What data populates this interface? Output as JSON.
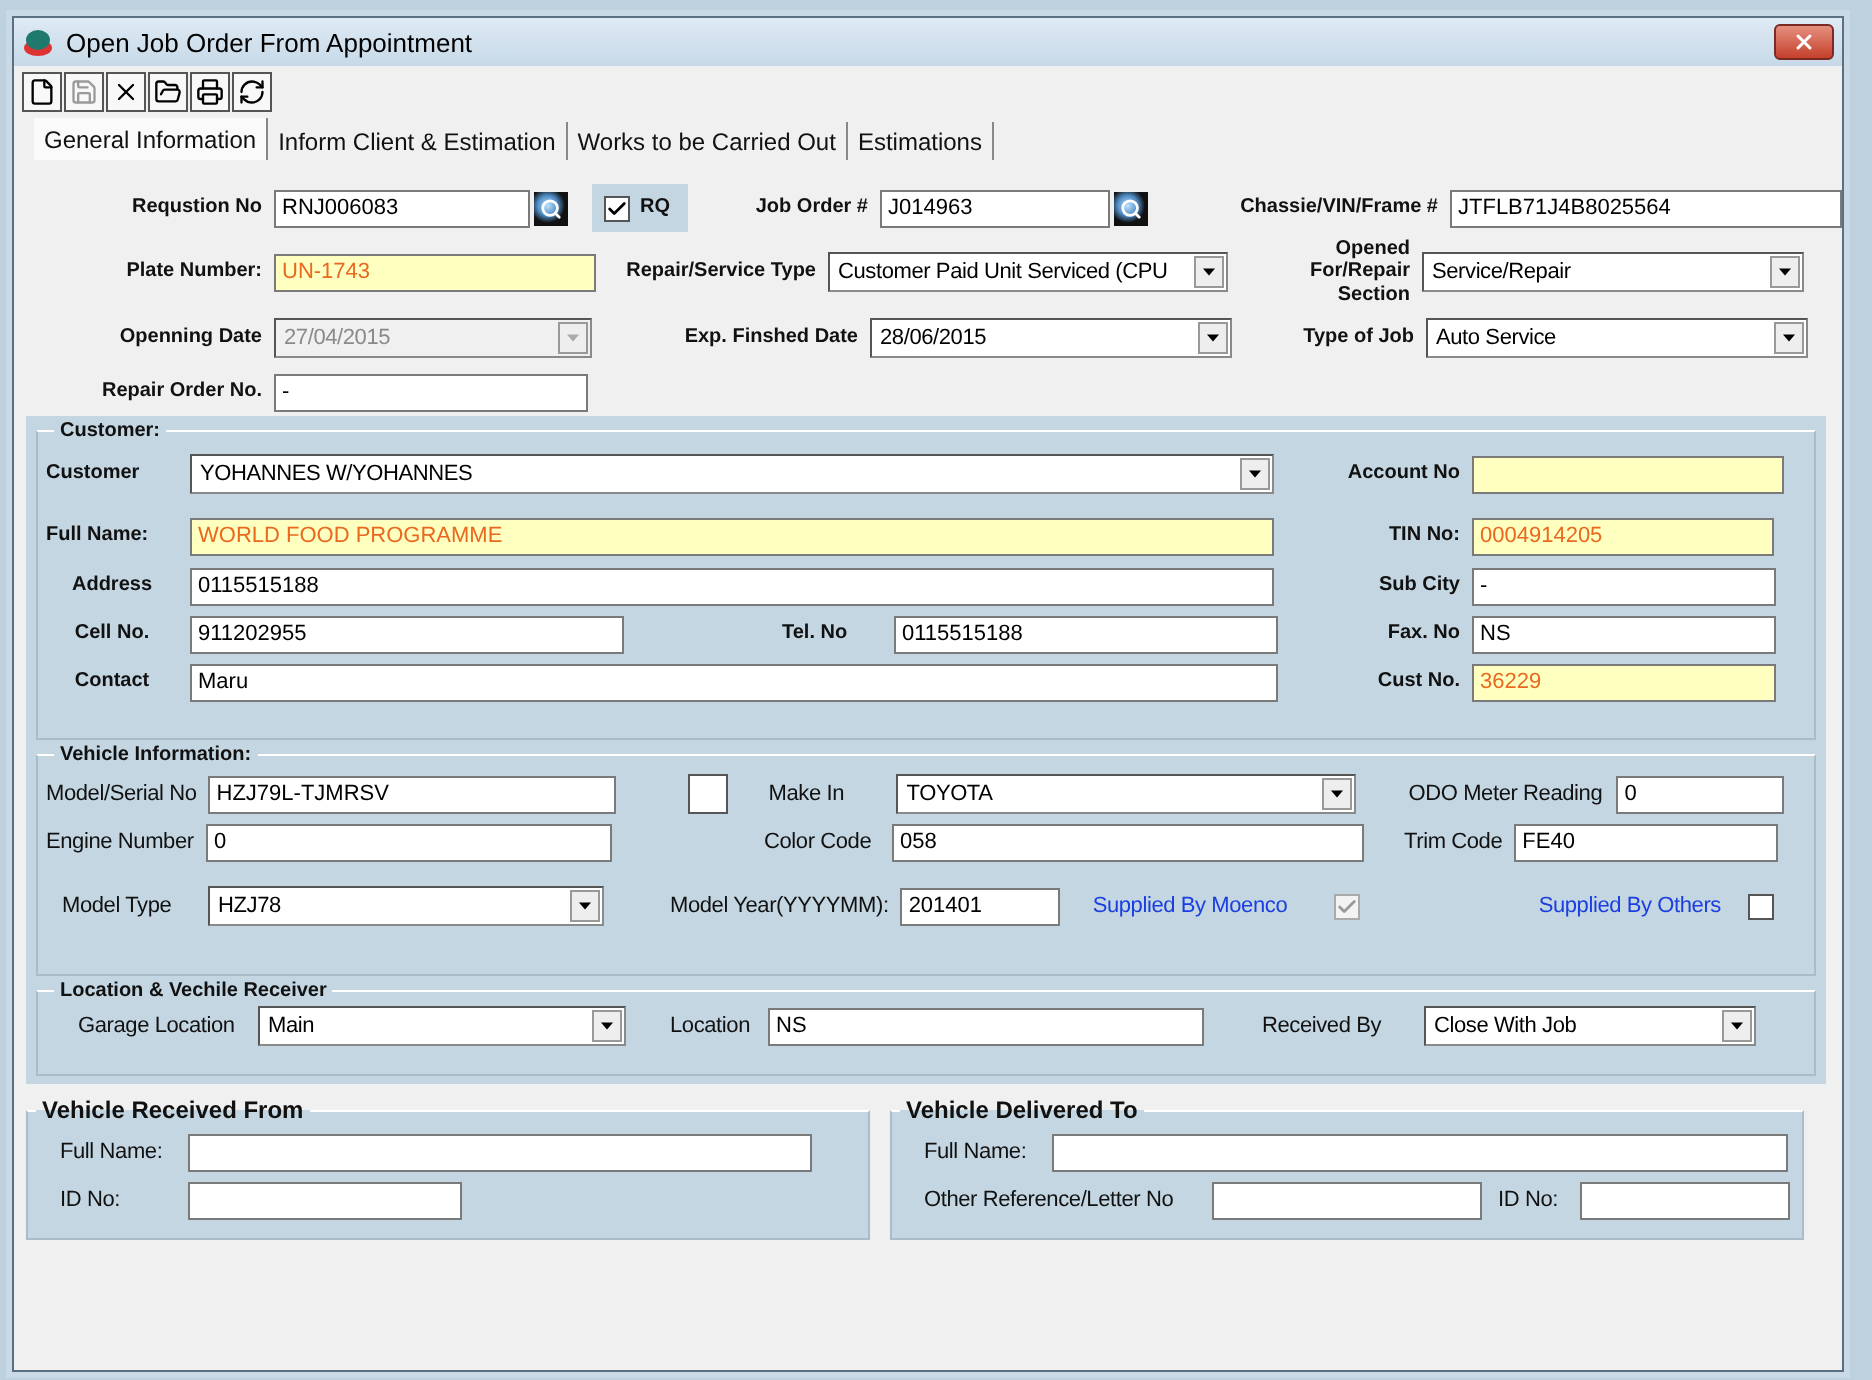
{
  "window": {
    "title": "Open Job Order From Appointment"
  },
  "toolbar": [
    {
      "kind": "new",
      "disabled": false
    },
    {
      "kind": "save",
      "disabled": true
    },
    {
      "kind": "delete",
      "disabled": false
    },
    {
      "kind": "open",
      "disabled": false
    },
    {
      "kind": "print",
      "disabled": false
    },
    {
      "kind": "refresh",
      "disabled": false
    }
  ],
  "tabs": [
    {
      "label": "General Information",
      "selected": true
    },
    {
      "label": "Inform Client & Estimation",
      "selected": false
    },
    {
      "label": "Works to be Carried Out",
      "selected": false
    },
    {
      "label": "Estimations",
      "selected": false
    }
  ],
  "header": {
    "fields": [
      {
        "label": "Requstion No",
        "kind": "lookup",
        "value": "RNJ006083",
        "highlighted": false,
        "disabled": false
      },
      {
        "label": "RQ",
        "kind": "checkbox",
        "checked": true,
        "disabled": false
      },
      {
        "label": "Job Order #",
        "kind": "lookup",
        "value": "J014963",
        "highlighted": false,
        "disabled": false
      },
      {
        "label": "Chassie/VIN/Frame #",
        "kind": "text",
        "value": "JTFLB71J4B8025564",
        "highlighted": false,
        "disabled": false
      },
      {
        "label": "Plate Number:",
        "kind": "text",
        "value": "UN-1743",
        "highlighted": true,
        "disabled": false
      },
      {
        "label": "Repair/Service Type",
        "kind": "combo",
        "value": "Customer Paid Unit Serviced (CPU",
        "highlighted": false,
        "disabled": false
      },
      {
        "label": "Opened For/Repair Section",
        "kind": "combo",
        "value": "Service/Repair",
        "highlighted": false,
        "disabled": false
      },
      {
        "label": "Openning Date",
        "kind": "combo",
        "value": "27/04/2015",
        "highlighted": false,
        "disabled": true
      },
      {
        "label": "Exp. Finshed Date",
        "kind": "combo",
        "value": "28/06/2015",
        "highlighted": false,
        "disabled": false
      },
      {
        "label": "Type of Job",
        "kind": "combo",
        "value": "Auto Service",
        "highlighted": false,
        "disabled": false
      },
      {
        "label": "Repair Order No.",
        "kind": "text",
        "value": "-",
        "highlighted": false,
        "disabled": false
      }
    ]
  },
  "customer": {
    "title": "Customer:",
    "fields": [
      {
        "label": "Customer",
        "kind": "combo",
        "value": "YOHANNES W/YOHANNES",
        "highlighted": false,
        "disabled": false
      },
      {
        "label": "Account No",
        "kind": "text",
        "highlighted": true,
        "disabled": false
      },
      {
        "label": "Full Name:",
        "kind": "text",
        "value": "WORLD FOOD PROGRAMME",
        "highlighted": true,
        "disabled": false
      },
      {
        "label": "TIN No:",
        "kind": "text",
        "value": "0004914205",
        "highlighted": true,
        "disabled": false
      },
      {
        "label": "Address",
        "kind": "text",
        "value": "0115515188",
        "highlighted": false,
        "disabled": false
      },
      {
        "label": "Sub City",
        "kind": "text",
        "value": "-",
        "highlighted": false,
        "disabled": false
      },
      {
        "label": "Cell No.",
        "kind": "text",
        "value": "911202955",
        "highlighted": false,
        "disabled": false
      },
      {
        "label": "Tel. No",
        "kind": "text",
        "value": "0115515188",
        "highlighted": false,
        "disabled": false
      },
      {
        "label": "Fax. No",
        "kind": "text",
        "value": "NS",
        "highlighted": false,
        "disabled": false
      },
      {
        "label": "Contact",
        "kind": "text",
        "value": "Maru",
        "highlighted": false,
        "disabled": false
      },
      {
        "label": "Cust No.",
        "kind": "text",
        "value": "36229",
        "highlighted": true,
        "disabled": false
      }
    ]
  },
  "vehicle": {
    "title": "Vehicle Information:",
    "fields": [
      {
        "label": "Model/Serial No",
        "kind": "text",
        "value": "HZJ79L-TJMRSV",
        "highlighted": false,
        "disabled": false
      },
      {
        "kind": "checkbox",
        "checked": false,
        "disabled": false
      },
      {
        "label": "Make In",
        "kind": "combo",
        "value": "TOYOTA",
        "highlighted": false,
        "disabled": false
      },
      {
        "label": "ODO Meter Reading",
        "kind": "text",
        "value": "0",
        "highlighted": false,
        "disabled": false
      },
      {
        "label": "Engine Number",
        "kind": "text",
        "value": "0",
        "highlighted": false,
        "disabled": false
      },
      {
        "label": "Color Code",
        "kind": "text",
        "value": "058",
        "highlighted": false,
        "disabled": false
      },
      {
        "label": "Trim Code",
        "kind": "text",
        "value": "FE40",
        "highlighted": false,
        "disabled": false
      },
      {
        "label": "Model Type",
        "kind": "combo",
        "value": "HZJ78",
        "highlighted": false,
        "disabled": false
      },
      {
        "label": "Model Year(YYYYMM):",
        "kind": "text",
        "value": "201401",
        "highlighted": false,
        "disabled": false
      },
      {
        "label": "Supplied By Moenco",
        "kind": "checkbox",
        "checked": true,
        "disabled": true
      },
      {
        "label": "Supplied By Others",
        "kind": "checkbox",
        "checked": false,
        "disabled": false
      }
    ]
  },
  "location": {
    "title": "Location & Vechile Receiver",
    "fields": [
      {
        "label": "Garage Location",
        "kind": "combo",
        "value": "Main",
        "highlighted": false,
        "disabled": false
      },
      {
        "label": "Location",
        "kind": "text",
        "value": "NS",
        "highlighted": false,
        "disabled": false
      },
      {
        "label": "Received By",
        "kind": "combo",
        "value": "Close With Job",
        "highlighted": false,
        "disabled": false
      }
    ]
  },
  "received_from": {
    "title": "Vehicle Received From",
    "fields": [
      {
        "label": "Full Name:",
        "kind": "text",
        "highlighted": false,
        "disabled": false
      },
      {
        "label": "ID No:",
        "kind": "text",
        "highlighted": false,
        "disabled": false
      }
    ]
  },
  "delivered_to": {
    "title": "Vehicle Delivered To",
    "fields": [
      {
        "label": "Full Name:",
        "kind": "text",
        "highlighted": false,
        "disabled": false
      },
      {
        "label": "Other Reference/Letter  No",
        "kind": "text",
        "highlighted": false,
        "disabled": false
      },
      {
        "label": "ID No:",
        "kind": "text",
        "highlighted": false,
        "disabled": false
      }
    ]
  }
}
